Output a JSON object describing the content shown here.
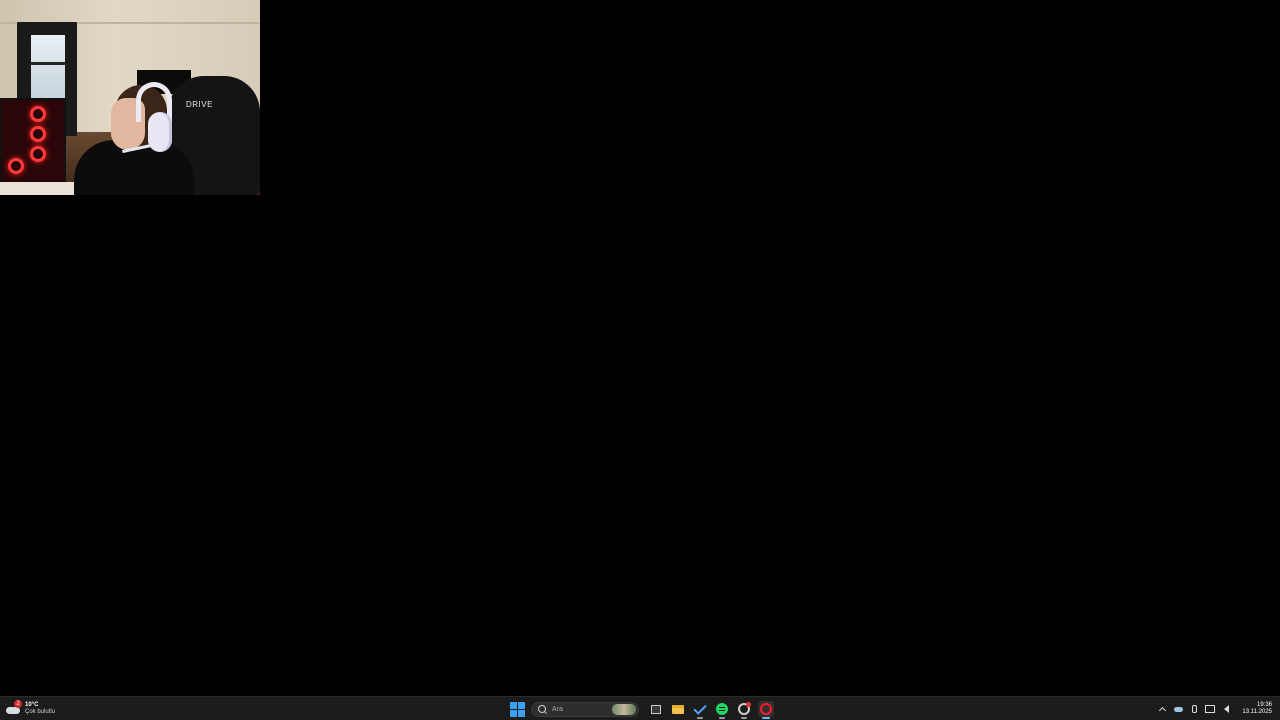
{
  "webcam": {
    "chair_brand": "DRIVE"
  },
  "taskbar": {
    "weather": {
      "temperature": "10°C",
      "description": "Çok bulutlu",
      "alert_count": "2"
    },
    "search": {
      "placeholder": "Ara"
    },
    "apps": [
      {
        "name": "Task View",
        "icon": "task-view-icon"
      },
      {
        "name": "File Explorer",
        "icon": "folder-icon"
      },
      {
        "name": "Microsoft To Do",
        "icon": "checkmark-icon"
      },
      {
        "name": "Spotify",
        "icon": "spotify-icon"
      },
      {
        "name": "Browser",
        "icon": "browser-icon"
      },
      {
        "name": "Opera GX",
        "icon": "opera-icon"
      }
    ],
    "clock": {
      "time": "19:36",
      "date": "13.11.2025"
    }
  }
}
